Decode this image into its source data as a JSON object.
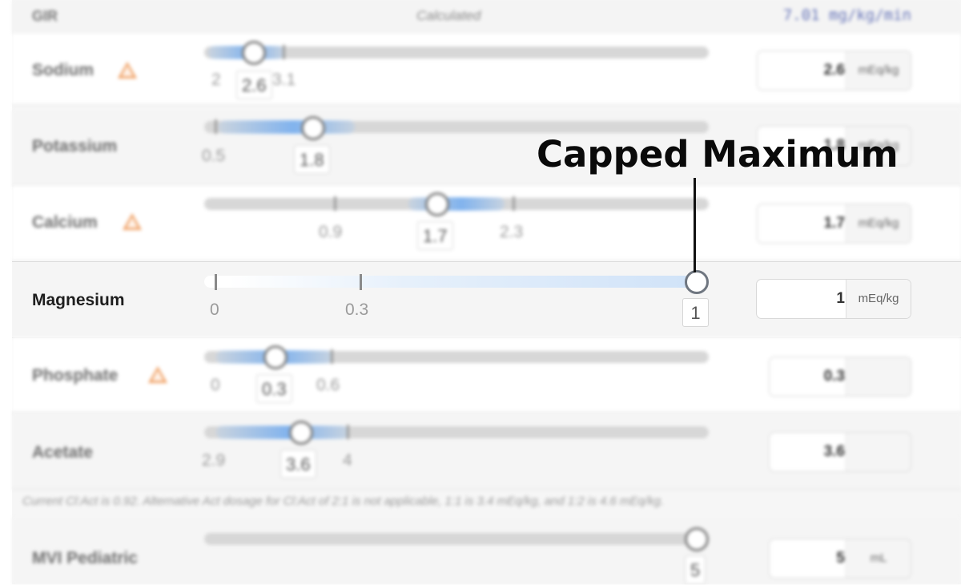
{
  "gir": {
    "label": "GIR",
    "status": "Calculated",
    "value": "7.01 mg/kg/min"
  },
  "rows": {
    "sodium": {
      "label": "Sodium",
      "warning": true,
      "min": "2",
      "max": "3.1",
      "current": "2.6",
      "input_value": "2.6",
      "unit": "mEq/kg"
    },
    "potassium": {
      "label": "Potassium",
      "warning": false,
      "min": "0.5",
      "current": "1.8",
      "input_value": "1.8",
      "unit": "mEq/kg"
    },
    "calcium": {
      "label": "Calcium",
      "warning": true,
      "min": "0.9",
      "max": "2.3",
      "current": "1.7",
      "input_value": "1.7",
      "unit": "mEq/kg"
    },
    "magnesium": {
      "label": "Magnesium",
      "warning": false,
      "min": "0",
      "max": "0.3",
      "current": "1",
      "input_value": "1",
      "unit": "mEq/kg"
    },
    "phosphate": {
      "label": "Phosphate",
      "warning": true,
      "min": "0",
      "max": "0.6",
      "current": "0.3",
      "input_value": "0.3",
      "unit": ""
    },
    "acetate": {
      "label": "Acetate",
      "warning": false,
      "min": "2.9",
      "max": "4",
      "current": "3.6",
      "input_value": "3.6",
      "unit": ""
    },
    "mvi": {
      "label": "MVI Pediatric",
      "warning": false,
      "current": "5",
      "input_value": "5",
      "unit": "mL"
    }
  },
  "note": "Current Cl:Act is 0.92. Alternative Act dosage for Cl:Act of 2:1 is not applicable, 1:1 is 3.4 mEq/kg, and 1:2 is 4.6 mEq/kg.",
  "annotation": "Capped Maximum",
  "colors": {
    "accent": "#4a90e2",
    "warning": "#f0a56c",
    "gir_value": "#6674b8"
  }
}
